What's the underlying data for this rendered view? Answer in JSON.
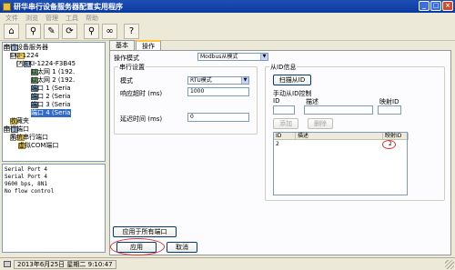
{
  "window": {
    "title": "研华串行设备服务器配置实用程序"
  },
  "menu": [
    "文件",
    "浏览",
    "管理",
    "工具",
    "帮助"
  ],
  "toolbar": [
    {
      "name": "computer-icon",
      "glyph": "⌂"
    },
    {
      "name": "search-icon",
      "glyph": "⚲"
    },
    {
      "name": "edit-icon",
      "glyph": "✎"
    },
    {
      "name": "refresh-icon",
      "glyph": "⟳"
    },
    {
      "name": "find-icon",
      "glyph": "⚲"
    },
    {
      "name": "binoculars-icon",
      "glyph": "∞"
    },
    {
      "name": "help-icon",
      "glyph": "?"
    }
  ],
  "tree": {
    "root": "串行设备服务器",
    "device": "EKI-1224",
    "server": "(*)EKI-1224-F3B45",
    "eth1": "以太网 1 (192.",
    "eth2": "以太网 2 (192.",
    "port1": "端口 1 (Seria",
    "port2": "端口 2 (Seria",
    "port3": "端口 3 (Seria",
    "port4": "端口 4 (Seria",
    "favorites": "收藏夹",
    "serial_ports": "串行端口",
    "system_serial": "系统串行端口",
    "virtual_com": "虚拟COM端口"
  },
  "info_lines": [
    "Serial Port 4",
    "Serial Port 4",
    "9600 bps, 8N1",
    "No flow control"
  ],
  "tabs": [
    "基本",
    "操作"
  ],
  "form": {
    "operation_mode_label": "操作模式",
    "operation_mode_value": "Modbus从模式",
    "serial_group": "串行设置",
    "mode_label": "模式",
    "mode_value": "RTU模式",
    "response_timeout_label": "响应超时 (ms)",
    "response_timeout_value": "1000",
    "delay_label": "延迟时间 (ms)",
    "delay_value": "0"
  },
  "slave": {
    "group": "从ID信息",
    "scan_button": "扫描从ID",
    "manual_label": "手动从ID控制",
    "id_label": "ID",
    "desc_label": "描述",
    "mapped_label": "映射ID",
    "add_button": "添加",
    "delete_button": "删除",
    "columns": [
      "ID",
      "描述",
      "映射ID"
    ],
    "rows": [
      {
        "id": "2",
        "desc": "",
        "mapped": "2"
      }
    ]
  },
  "buttons": {
    "apply_all": "应用于所有端口",
    "apply": "应用",
    "cancel": "取消"
  },
  "status": {
    "text": "2013年6月25日 星期二  9:10:47"
  }
}
